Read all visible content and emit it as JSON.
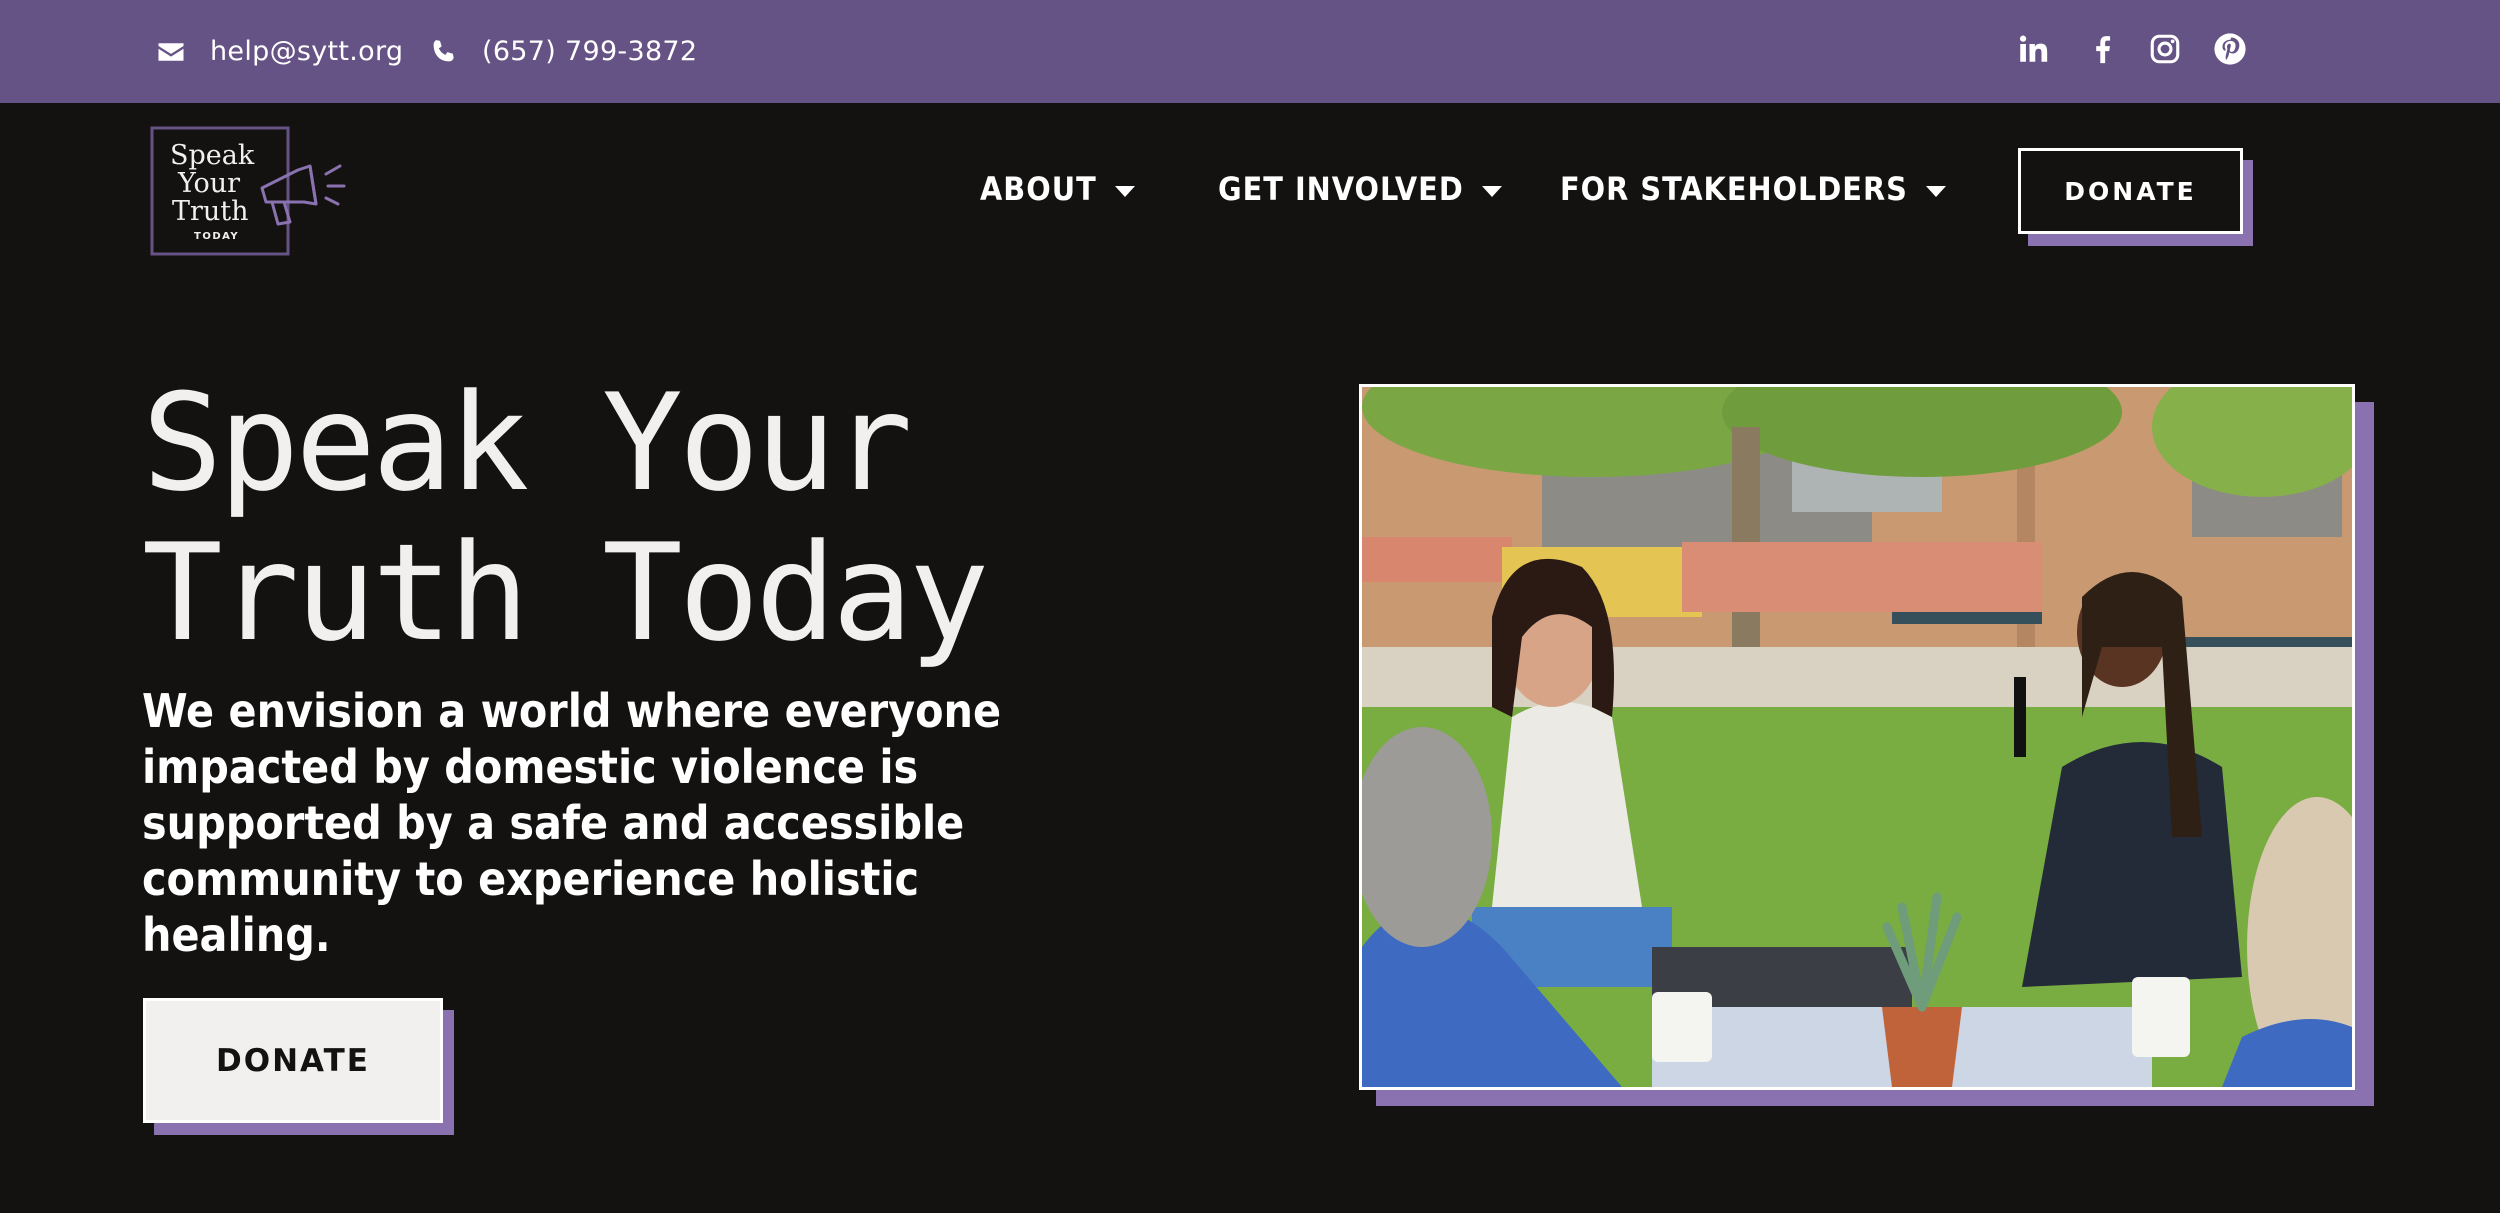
{
  "topbar": {
    "email": "help@sytt.org",
    "phone": "(657) 799-3872",
    "social": [
      "linkedin-icon",
      "facebook-icon",
      "instagram-icon",
      "pinterest-icon"
    ],
    "background": "#665385"
  },
  "logo": {
    "line1": "Speak",
    "line2": "Your",
    "line3": "Truth",
    "line4": "TODAY"
  },
  "nav": {
    "items": [
      {
        "label": "ABOUT"
      },
      {
        "label": "GET INVOLVED"
      },
      {
        "label": "FOR STAKEHOLDERS"
      }
    ],
    "donate_label": "DONATE"
  },
  "hero": {
    "title_line1": "Speak Your",
    "title_line2": "Truth Today",
    "subtitle": "We envision a world where everyone impacted by domestic violence is supported by a safe and accessible community to experience holistic healing.",
    "donate_label": "DONATE"
  },
  "colors": {
    "accent": "#8a72b0",
    "background": "#141210",
    "text": "#ffffff"
  }
}
